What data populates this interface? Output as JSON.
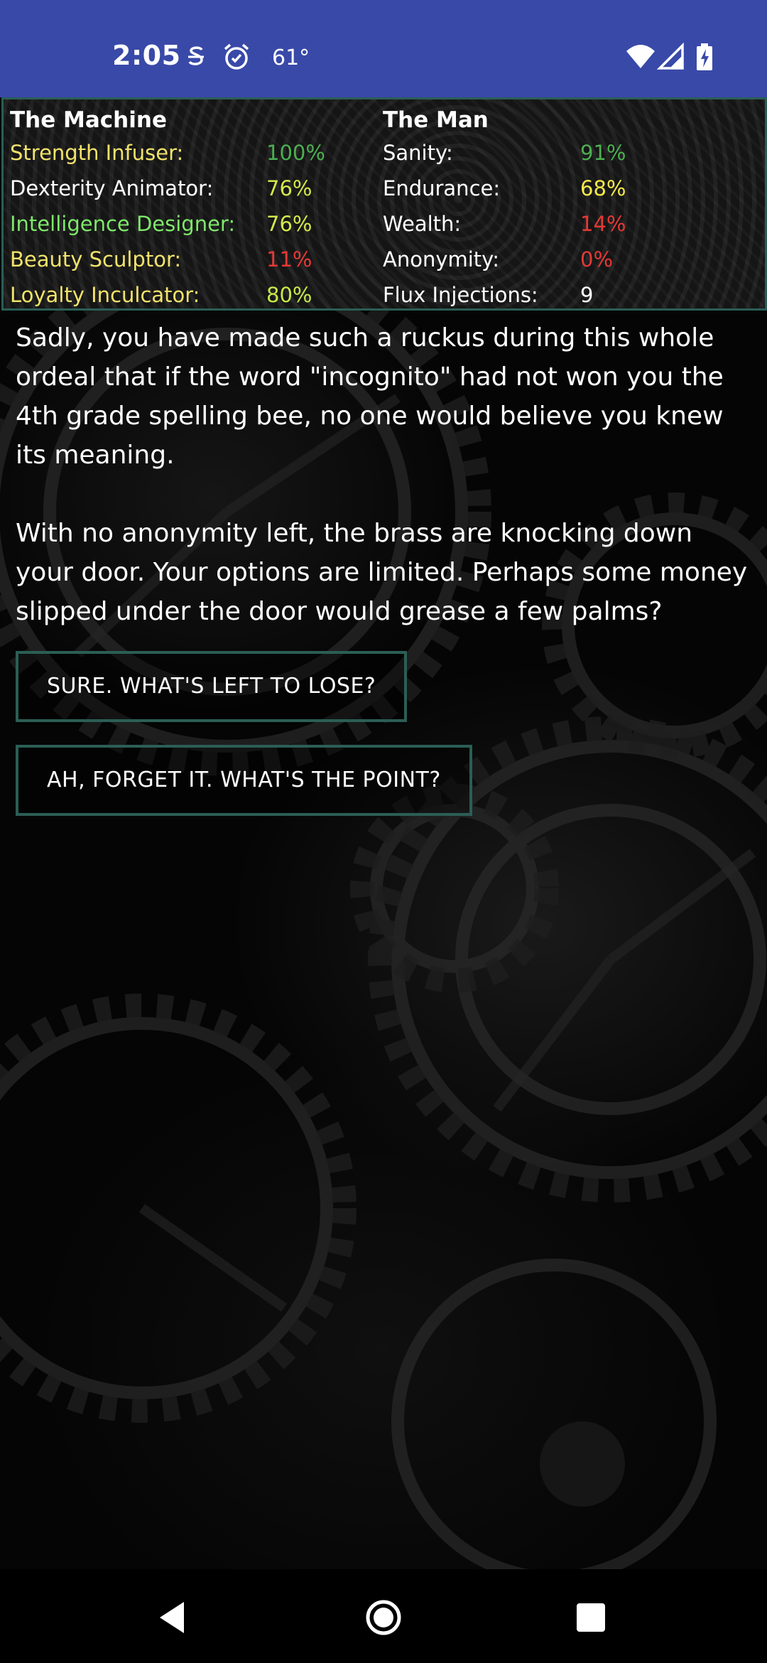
{
  "status_bar": {
    "time": "2:05",
    "temperature": "61°",
    "icons": [
      "s-notification-icon",
      "alarm-icon",
      "wifi-icon",
      "signal-icon",
      "battery-charging-icon"
    ]
  },
  "stats": {
    "machine": {
      "title": "The Machine",
      "rows": [
        {
          "label": "Strength Infuser:",
          "value": "100%",
          "label_color": "#f2e36b",
          "value_color": "#4caf50"
        },
        {
          "label": "Dexterity Animator:",
          "value": "76%",
          "label_color": "#ffffff",
          "value_color": "#d4e84a"
        },
        {
          "label": "Intelligence Designer:",
          "value": "76%",
          "label_color": "#7ee86a",
          "value_color": "#d4e84a"
        },
        {
          "label": "Beauty Sculptor:",
          "value": "11%",
          "label_color": "#f2e36b",
          "value_color": "#e53935"
        },
        {
          "label": "Loyalty Inculcator:",
          "value": "80%",
          "label_color": "#f2e36b",
          "value_color": "#c6e84a"
        }
      ]
    },
    "man": {
      "title": "The Man",
      "rows": [
        {
          "label": "Sanity:",
          "value": "91%",
          "label_color": "#ffffff",
          "value_color": "#4caf50"
        },
        {
          "label": "Endurance:",
          "value": "68%",
          "label_color": "#ffffff",
          "value_color": "#f5e94a"
        },
        {
          "label": "Wealth:",
          "value": "14%",
          "label_color": "#ffffff",
          "value_color": "#e53935"
        },
        {
          "label": "Anonymity:",
          "value": "0%",
          "label_color": "#ffffff",
          "value_color": "#e53935"
        },
        {
          "label": "Flux Injections:",
          "value": "9",
          "label_color": "#ffffff",
          "value_color": "#ffffff"
        }
      ]
    }
  },
  "story": {
    "paragraph_1": "Sadly, you have made such a ruckus during this whole ordeal that if the word \"incognito\" had not won you the 4th grade spelling bee, no one would believe you knew its meaning.",
    "paragraph_2": "With no anonymity left, the brass are knocking down your door. Your options are limited. Perhaps some money slipped under the door would grease a few palms?"
  },
  "choices": [
    {
      "label": "SURE. WHAT'S LEFT TO LOSE?"
    },
    {
      "label": "AH, FORGET IT. WHAT'S THE POINT?"
    }
  ],
  "nav_bar": {
    "icons": [
      "back-icon",
      "home-icon",
      "recents-icon"
    ]
  },
  "colors": {
    "status_bar": "#3949a8",
    "panel_border": "#2b5e55",
    "background": "#050505"
  }
}
